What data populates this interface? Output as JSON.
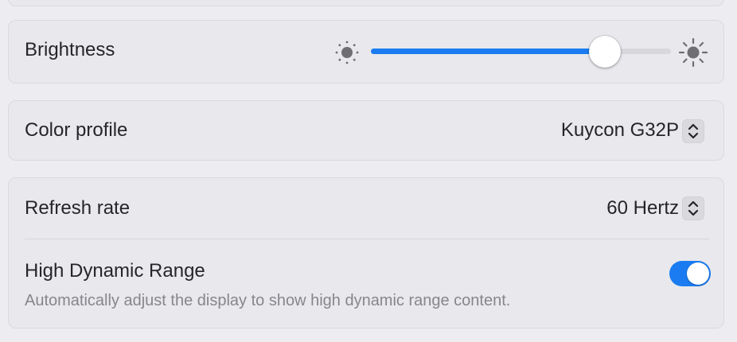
{
  "brightness": {
    "label": "Brightness",
    "level": 0.78,
    "icon_low": "sun-min-icon",
    "icon_high": "sun-max-icon"
  },
  "color_profile": {
    "label": "Color profile",
    "value": "Kuycon G32P",
    "icon": "updown-chevron-icon"
  },
  "refresh_rate": {
    "label": "Refresh rate",
    "value": "60 Hertz",
    "icon": "updown-chevron-icon"
  },
  "hdr": {
    "label": "High Dynamic Range",
    "description": "Automatically adjust the display to show high dynamic range content.",
    "enabled": true
  },
  "colors": {
    "accent": "#1a7cf0",
    "card_bg": "#e8e8ed",
    "window_bg": "#ededf1"
  }
}
